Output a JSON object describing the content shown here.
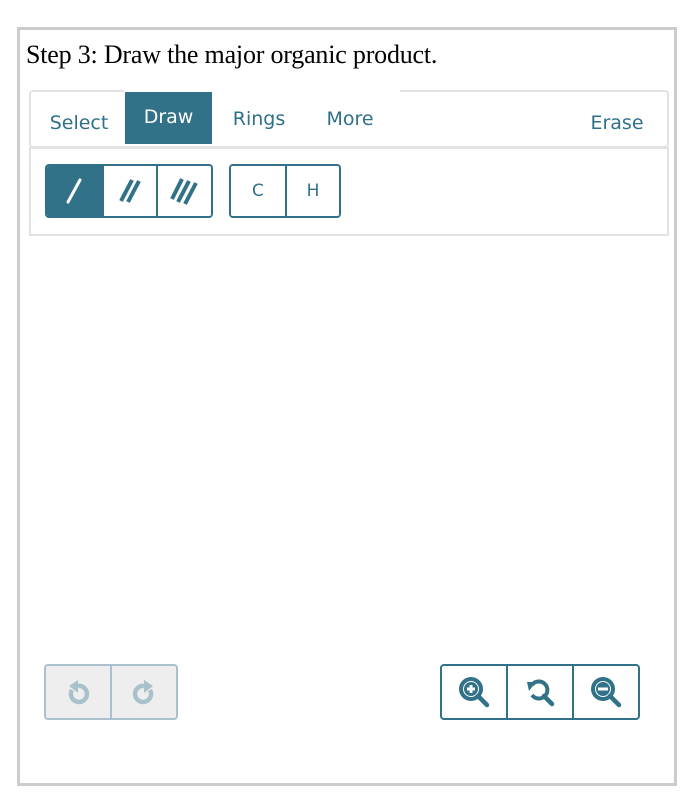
{
  "question": {
    "text": "Step 3: Draw the major organic product."
  },
  "colors": {
    "accent": "#327289",
    "disabled": "#a9c1cc",
    "border": "#cccccc"
  },
  "tabs": [
    {
      "label": "Select",
      "active": false
    },
    {
      "label": "Draw",
      "active": true
    },
    {
      "label": "Rings",
      "active": false
    },
    {
      "label": "More",
      "active": false
    }
  ],
  "erase_label": "Erase",
  "bond_tools": [
    {
      "name": "single-bond",
      "icon": "single-bond-icon",
      "active": true
    },
    {
      "name": "double-bond",
      "icon": "double-bond-icon",
      "active": false
    },
    {
      "name": "triple-bond",
      "icon": "triple-bond-icon",
      "active": false
    }
  ],
  "atom_tools": [
    {
      "label": "C"
    },
    {
      "label": "H"
    }
  ],
  "history": {
    "undo": {
      "icon": "undo-icon",
      "enabled": false
    },
    "redo": {
      "icon": "redo-icon",
      "enabled": false
    }
  },
  "zoom_controls": [
    {
      "icon": "zoom-in-icon"
    },
    {
      "icon": "zoom-reset-icon"
    },
    {
      "icon": "zoom-out-icon"
    }
  ]
}
